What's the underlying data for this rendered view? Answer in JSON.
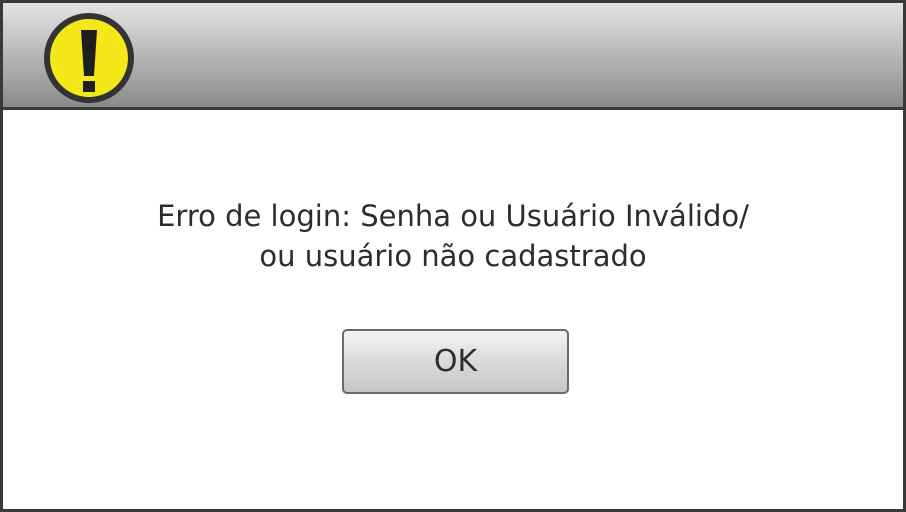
{
  "dialog": {
    "icon": "warning-exclamation-icon",
    "icon_color": "#f5e818",
    "message_line1": "Erro de login: Senha ou Usuário Inválido/",
    "message_line2": "ou usuário não cadastrado",
    "ok_label": "OK"
  }
}
